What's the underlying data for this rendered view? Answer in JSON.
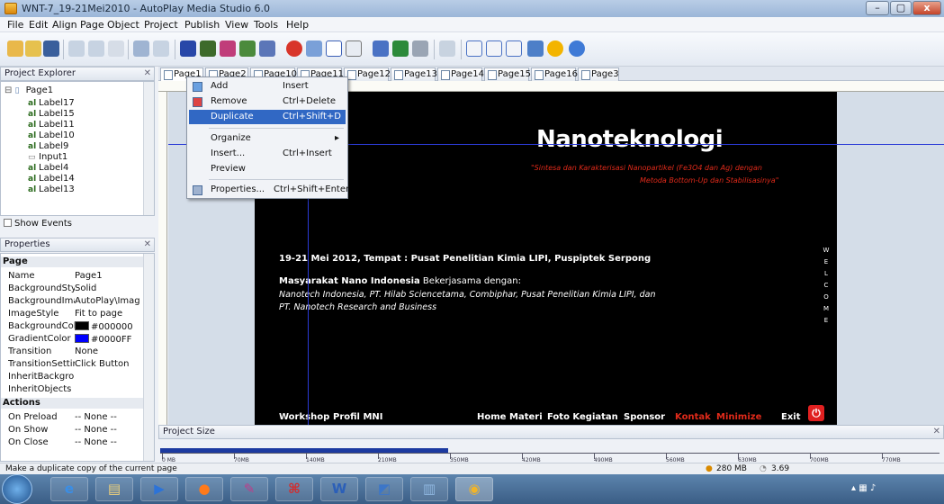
{
  "window": {
    "title": "WNT-7_19-21Mei2010 - AutoPlay Media Studio 6.0",
    "controls": [
      "–",
      "▢",
      "x"
    ]
  },
  "menubar": [
    "File",
    "Edit",
    "Align",
    "Page",
    "Object",
    "Project",
    "Publish",
    "View",
    "Tools",
    "Help"
  ],
  "project_explorer": {
    "title": "Project Explorer",
    "root": "Page1",
    "items": [
      "Label17",
      "Label15",
      "Label11",
      "Label10",
      "Label9",
      "Input1",
      "Label4",
      "Label14",
      "Label13"
    ],
    "show_events": "Show Events"
  },
  "properties": {
    "title": "Properties",
    "groups": [
      {
        "name": "Page",
        "rows": [
          {
            "name": "Name",
            "value": "Page1"
          },
          {
            "name": "BackgroundStyl",
            "value": "Solid"
          },
          {
            "name": "BackgroundIma",
            "value": "AutoPlay\\Imag"
          },
          {
            "name": "ImageStyle",
            "value": "Fit to page"
          },
          {
            "name": "BackgroundCol",
            "value": "#000000",
            "swatch": "#000000"
          },
          {
            "name": "GradientColor",
            "value": "#0000FF",
            "swatch": "#0000FF"
          },
          {
            "name": "Transition",
            "value": "None"
          },
          {
            "name": "TransitionSettin",
            "value": "Click Button"
          },
          {
            "name": "InheritBackgrou",
            "value": ""
          },
          {
            "name": "InheritObjects",
            "value": ""
          }
        ]
      },
      {
        "name": "Actions",
        "rows": [
          {
            "name": "On Preload",
            "value": "-- None --"
          },
          {
            "name": "On Show",
            "value": "-- None --"
          },
          {
            "name": "On Close",
            "value": "-- None --"
          }
        ]
      }
    ]
  },
  "tabs": [
    "Page1",
    "Page2",
    "Page10",
    "Page11",
    "Page12",
    "Page13",
    "Page14",
    "Page15",
    "Page16",
    "Page3"
  ],
  "context_menu": [
    {
      "label": "Add",
      "shortcut": "Insert",
      "icon": "add-icon"
    },
    {
      "label": "Remove",
      "shortcut": "Ctrl+Delete",
      "icon": "remove-icon"
    },
    {
      "label": "Duplicate",
      "shortcut": "Ctrl+Shift+D",
      "highlight": true
    },
    {
      "label": "Organize",
      "shortcut": "",
      "submenu": true
    },
    {
      "label": "Insert...",
      "shortcut": "Ctrl+Insert"
    },
    {
      "label": "Preview",
      "shortcut": ""
    },
    {
      "label": "Properties...",
      "shortcut": "Ctrl+Shift+Enter",
      "icon": "properties-icon"
    }
  ],
  "canvas": {
    "title": "Nanoteknologi",
    "subtitle_line1": "\"Sintesa dan Karakterisasi Nanopartikel (Fe3O4 dan Ag) dengan",
    "subtitle_line2": "Metoda Bottom-Up dan Stabilisasinya\"",
    "event": "19-21 Mei 2012, Tempat  :  Pusat Penelitian Kimia LIPI, Puspiptek Serpong",
    "masy_bold": "Masyarakat  Nano Indonesia",
    "masy_rest": " Bekerjasama dengan:",
    "partners_line1": "Nanotech Indonesia, PT. Hilab Sciencetama, Combiphar, Pusat Penelitian Kimia LIPI, dan",
    "partners_line2": "PT. Nanotech Research and Business",
    "welcome": [
      "W",
      "E",
      "L",
      "C",
      "O",
      "M",
      "E"
    ],
    "nav": [
      {
        "label": "Workshop",
        "color": "#ffffff"
      },
      {
        "label": "Profil MNI",
        "color": "#ffffff"
      },
      {
        "label": "Home",
        "color": "#ffffff"
      },
      {
        "label": "Materi",
        "color": "#ffffff"
      },
      {
        "label": "Foto Kegiatan",
        "color": "#ffffff"
      },
      {
        "label": "Sponsor",
        "color": "#ffffff"
      },
      {
        "label": "Kontak",
        "color": "#e02a1a"
      },
      {
        "label": "Minimize",
        "color": "#e02a1a"
      },
      {
        "label": "Exit",
        "color": "#ffffff"
      }
    ]
  },
  "project_size": {
    "title": "Project Size",
    "ticks": [
      "0 MB",
      "70MB",
      "140MB",
      "210MB",
      "350MB",
      "420MB",
      "490MB",
      "560MB",
      "630MB",
      "700MB",
      "770MB"
    ]
  },
  "statusbar": {
    "message": "Make a duplicate copy of the current page",
    "memory": "280 MB",
    "zoom": "3.69"
  },
  "colors": {
    "accent": "#3168c4",
    "page_bg": "#000000",
    "guide": "#2b3bd6",
    "red_text": "#e02a1a"
  }
}
